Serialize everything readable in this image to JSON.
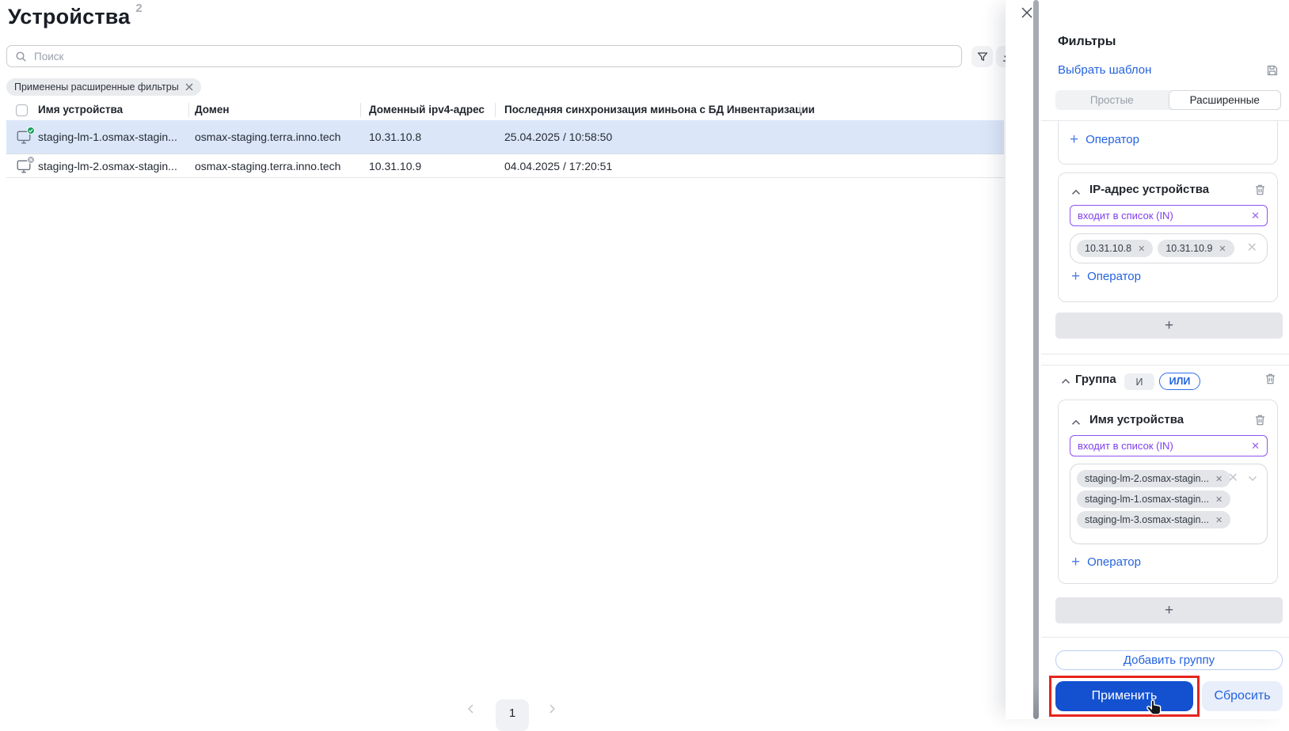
{
  "page": {
    "title": "Устройства",
    "count": "2"
  },
  "toolbar": {
    "search_placeholder": "Поиск",
    "applied_filters": "Применены расширенные фильтры"
  },
  "table": {
    "headers": {
      "name": "Имя устройства",
      "domain": "Домен",
      "ip": "Доменный ipv4-адрес",
      "sync": "Последняя синхронизация миньона с БД Инвентаризации"
    },
    "rows": [
      {
        "name": "staging-lm-1.osmax-stagin...",
        "domain": "osmax-staging.terra.inno.tech",
        "ip": "10.31.10.8",
        "sync": "25.04.2025 / 10:58:50",
        "status": "connected"
      },
      {
        "name": "staging-lm-2.osmax-stagin...",
        "domain": "osmax-staging.terra.inno.tech",
        "ip": "10.31.10.9",
        "sync": "04.04.2025 / 17:20:51",
        "status": "disconnected"
      }
    ]
  },
  "pagination": {
    "current_page": "1"
  },
  "filters": {
    "title": "Фильтры",
    "choose_template": "Выбрать шаблон",
    "tabs": {
      "simple": "Простые",
      "advanced": "Расширенные"
    },
    "operator_link": "Оператор",
    "group_top": {
      "ip_condition": {
        "title": "IP-адрес устройства",
        "operator": "входит в список (IN)",
        "values": [
          "10.31.10.8",
          "10.31.10.9"
        ]
      }
    },
    "group_bottom": {
      "label": "Группа",
      "and_label": "И",
      "or_label": "ИЛИ",
      "name_condition": {
        "title": "Имя устройства",
        "operator": "входит в список (IN)",
        "values": [
          "staging-lm-2.osmax-stagin...",
          "staging-lm-1.osmax-stagin...",
          "staging-lm-3.osmax-stagin..."
        ]
      }
    },
    "add_group": "Добавить группу",
    "apply": "Применить",
    "reset": "Сбросить"
  },
  "colors": {
    "accent_blue": "#2463de",
    "apply_blue": "#1351d0",
    "purple": "#8744ef",
    "row_highlight": "#dbe7f9",
    "annotation_red": "#e6251c",
    "status_green": "#16a05d",
    "status_gray": "#a6abb4"
  }
}
